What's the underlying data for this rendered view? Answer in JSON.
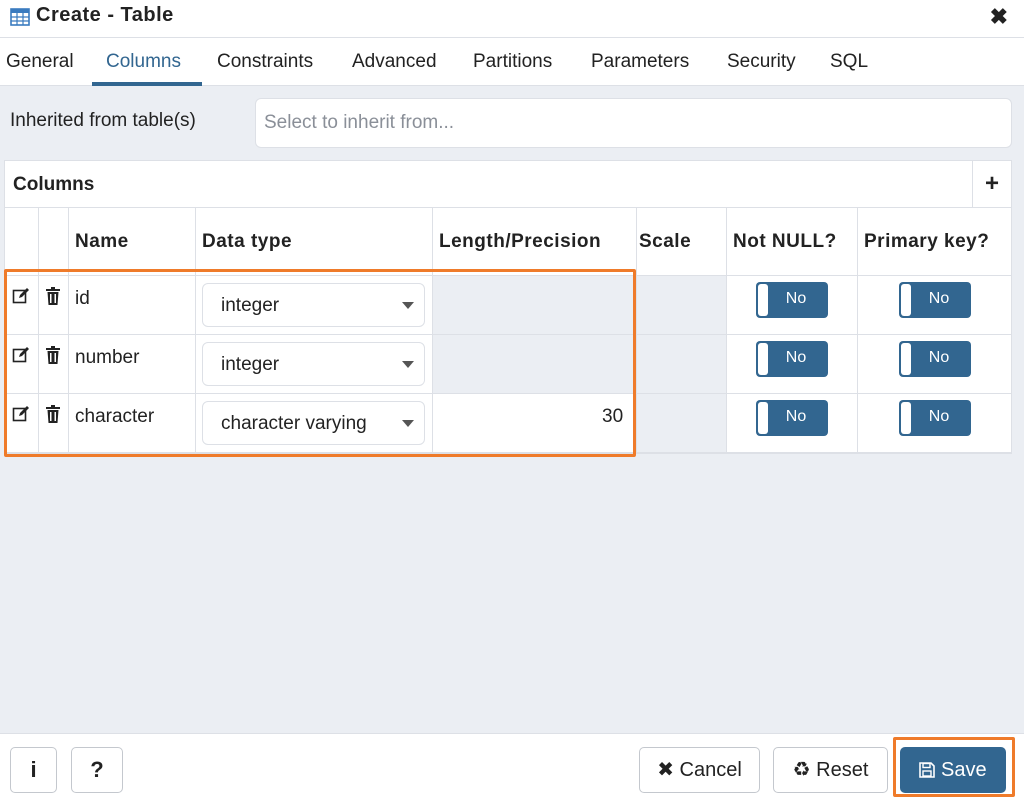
{
  "window": {
    "title": "Create - Table",
    "icon": "table-icon",
    "close_icon": "close-icon"
  },
  "tabs": [
    {
      "label": "General"
    },
    {
      "label": "Columns",
      "active": true
    },
    {
      "label": "Constraints"
    },
    {
      "label": "Advanced"
    },
    {
      "label": "Partitions"
    },
    {
      "label": "Parameters"
    },
    {
      "label": "Security"
    },
    {
      "label": "SQL"
    }
  ],
  "inherit": {
    "label": "Inherited from table(s)",
    "placeholder": "Select to inherit from..."
  },
  "grid": {
    "title": "Columns",
    "add_icon": "plus-icon",
    "headers": [
      "Name",
      "Data type",
      "Length/Precision",
      "Scale",
      "Not NULL?",
      "Primary key?"
    ],
    "rows": [
      {
        "name": "id",
        "data_type": "integer",
        "length": "",
        "scale": "",
        "not_null": "No",
        "primary_key": "No"
      },
      {
        "name": "number",
        "data_type": "integer",
        "length": "",
        "scale": "",
        "not_null": "No",
        "primary_key": "No"
      },
      {
        "name": "character",
        "data_type": "character varying",
        "length": "30",
        "scale": "",
        "not_null": "No",
        "primary_key": "No"
      }
    ]
  },
  "footer": {
    "info_label": "i",
    "help_label": "?",
    "cancel_label": "Cancel",
    "reset_label": "Reset",
    "save_label": "Save"
  },
  "colors": {
    "accent": "#326690",
    "highlight": "#ef7b2a",
    "background": "#ebeef3"
  }
}
